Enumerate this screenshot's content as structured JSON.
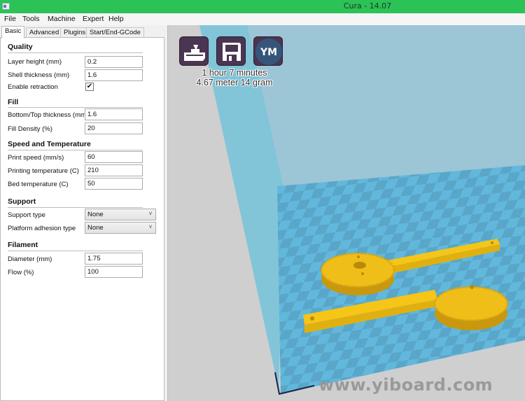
{
  "window": {
    "title": "Cura - 14.07",
    "icon": "app-icon"
  },
  "menu": [
    "File",
    "Tools",
    "Machine",
    "Expert",
    "Help"
  ],
  "tabs": [
    {
      "label": "Basic",
      "active": true
    },
    {
      "label": "Advanced",
      "active": false
    },
    {
      "label": "Plugins",
      "active": false
    },
    {
      "label": "Start/End-GCode",
      "active": false
    }
  ],
  "sections": {
    "quality": {
      "title": "Quality",
      "layer_height": {
        "label": "Layer height (mm)",
        "value": "0.2"
      },
      "shell_thickness": {
        "label": "Shell thickness (mm)",
        "value": "1.6"
      },
      "enable_retraction": {
        "label": "Enable retraction",
        "checked": true,
        "glyph": "✔"
      }
    },
    "fill": {
      "title": "Fill",
      "bottom_top_thickness": {
        "label": "Bottom/Top thickness (mm)",
        "value": "1.6"
      },
      "fill_density": {
        "label": "Fill Density (%)",
        "value": "20"
      }
    },
    "speed": {
      "title": "Speed and Temperature",
      "print_speed": {
        "label": "Print speed (mm/s)",
        "value": "60"
      },
      "printing_temperature": {
        "label": "Printing temperature (C)",
        "value": "210"
      },
      "bed_temperature": {
        "label": "Bed temperature (C)",
        "value": "50"
      }
    },
    "support": {
      "title": "Support",
      "support_type": {
        "label": "Support type",
        "value": "None"
      },
      "platform_adhesion": {
        "label": "Platform adhesion type",
        "value": "None"
      }
    },
    "filament": {
      "title": "Filament",
      "diameter": {
        "label": "Diameter (mm)",
        "value": "1.75"
      },
      "flow": {
        "label": "Flow (%)",
        "value": "100"
      }
    }
  },
  "viewport": {
    "toolbar": [
      {
        "name": "load-model-icon"
      },
      {
        "name": "save-gcode-icon"
      },
      {
        "name": "youmagine-icon",
        "text": "YM"
      }
    ],
    "print_time": "1 hour 7 minutes",
    "print_material": "4.67 meter 14 gram",
    "colors": {
      "build_volume": "#9cc5d6",
      "build_volume_side": "#82c4d8",
      "plate_light": "#62b8dc",
      "plate_dark": "#5aa6c8",
      "model": "#f5c518",
      "model_shadow": "#c9980e"
    }
  },
  "watermark": "www.yiboard.com",
  "select_arrow": "v"
}
